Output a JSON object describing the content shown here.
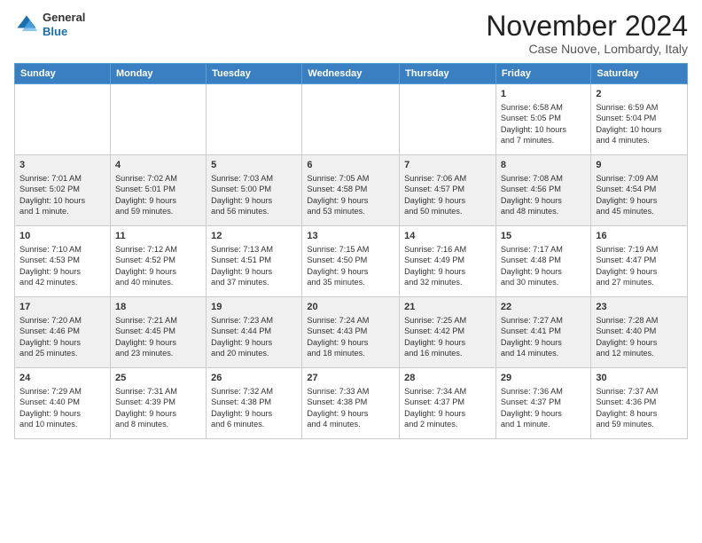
{
  "header": {
    "logo_line1": "General",
    "logo_line2": "Blue",
    "month": "November 2024",
    "location": "Case Nuove, Lombardy, Italy"
  },
  "weekdays": [
    "Sunday",
    "Monday",
    "Tuesday",
    "Wednesday",
    "Thursday",
    "Friday",
    "Saturday"
  ],
  "rows": [
    [
      {
        "day": "",
        "info": ""
      },
      {
        "day": "",
        "info": ""
      },
      {
        "day": "",
        "info": ""
      },
      {
        "day": "",
        "info": ""
      },
      {
        "day": "",
        "info": ""
      },
      {
        "day": "1",
        "info": "Sunrise: 6:58 AM\nSunset: 5:05 PM\nDaylight: 10 hours\nand 7 minutes."
      },
      {
        "day": "2",
        "info": "Sunrise: 6:59 AM\nSunset: 5:04 PM\nDaylight: 10 hours\nand 4 minutes."
      }
    ],
    [
      {
        "day": "3",
        "info": "Sunrise: 7:01 AM\nSunset: 5:02 PM\nDaylight: 10 hours\nand 1 minute."
      },
      {
        "day": "4",
        "info": "Sunrise: 7:02 AM\nSunset: 5:01 PM\nDaylight: 9 hours\nand 59 minutes."
      },
      {
        "day": "5",
        "info": "Sunrise: 7:03 AM\nSunset: 5:00 PM\nDaylight: 9 hours\nand 56 minutes."
      },
      {
        "day": "6",
        "info": "Sunrise: 7:05 AM\nSunset: 4:58 PM\nDaylight: 9 hours\nand 53 minutes."
      },
      {
        "day": "7",
        "info": "Sunrise: 7:06 AM\nSunset: 4:57 PM\nDaylight: 9 hours\nand 50 minutes."
      },
      {
        "day": "8",
        "info": "Sunrise: 7:08 AM\nSunset: 4:56 PM\nDaylight: 9 hours\nand 48 minutes."
      },
      {
        "day": "9",
        "info": "Sunrise: 7:09 AM\nSunset: 4:54 PM\nDaylight: 9 hours\nand 45 minutes."
      }
    ],
    [
      {
        "day": "10",
        "info": "Sunrise: 7:10 AM\nSunset: 4:53 PM\nDaylight: 9 hours\nand 42 minutes."
      },
      {
        "day": "11",
        "info": "Sunrise: 7:12 AM\nSunset: 4:52 PM\nDaylight: 9 hours\nand 40 minutes."
      },
      {
        "day": "12",
        "info": "Sunrise: 7:13 AM\nSunset: 4:51 PM\nDaylight: 9 hours\nand 37 minutes."
      },
      {
        "day": "13",
        "info": "Sunrise: 7:15 AM\nSunset: 4:50 PM\nDaylight: 9 hours\nand 35 minutes."
      },
      {
        "day": "14",
        "info": "Sunrise: 7:16 AM\nSunset: 4:49 PM\nDaylight: 9 hours\nand 32 minutes."
      },
      {
        "day": "15",
        "info": "Sunrise: 7:17 AM\nSunset: 4:48 PM\nDaylight: 9 hours\nand 30 minutes."
      },
      {
        "day": "16",
        "info": "Sunrise: 7:19 AM\nSunset: 4:47 PM\nDaylight: 9 hours\nand 27 minutes."
      }
    ],
    [
      {
        "day": "17",
        "info": "Sunrise: 7:20 AM\nSunset: 4:46 PM\nDaylight: 9 hours\nand 25 minutes."
      },
      {
        "day": "18",
        "info": "Sunrise: 7:21 AM\nSunset: 4:45 PM\nDaylight: 9 hours\nand 23 minutes."
      },
      {
        "day": "19",
        "info": "Sunrise: 7:23 AM\nSunset: 4:44 PM\nDaylight: 9 hours\nand 20 minutes."
      },
      {
        "day": "20",
        "info": "Sunrise: 7:24 AM\nSunset: 4:43 PM\nDaylight: 9 hours\nand 18 minutes."
      },
      {
        "day": "21",
        "info": "Sunrise: 7:25 AM\nSunset: 4:42 PM\nDaylight: 9 hours\nand 16 minutes."
      },
      {
        "day": "22",
        "info": "Sunrise: 7:27 AM\nSunset: 4:41 PM\nDaylight: 9 hours\nand 14 minutes."
      },
      {
        "day": "23",
        "info": "Sunrise: 7:28 AM\nSunset: 4:40 PM\nDaylight: 9 hours\nand 12 minutes."
      }
    ],
    [
      {
        "day": "24",
        "info": "Sunrise: 7:29 AM\nSunset: 4:40 PM\nDaylight: 9 hours\nand 10 minutes."
      },
      {
        "day": "25",
        "info": "Sunrise: 7:31 AM\nSunset: 4:39 PM\nDaylight: 9 hours\nand 8 minutes."
      },
      {
        "day": "26",
        "info": "Sunrise: 7:32 AM\nSunset: 4:38 PM\nDaylight: 9 hours\nand 6 minutes."
      },
      {
        "day": "27",
        "info": "Sunrise: 7:33 AM\nSunset: 4:38 PM\nDaylight: 9 hours\nand 4 minutes."
      },
      {
        "day": "28",
        "info": "Sunrise: 7:34 AM\nSunset: 4:37 PM\nDaylight: 9 hours\nand 2 minutes."
      },
      {
        "day": "29",
        "info": "Sunrise: 7:36 AM\nSunset: 4:37 PM\nDaylight: 9 hours\nand 1 minute."
      },
      {
        "day": "30",
        "info": "Sunrise: 7:37 AM\nSunset: 4:36 PM\nDaylight: 8 hours\nand 59 minutes."
      }
    ]
  ]
}
